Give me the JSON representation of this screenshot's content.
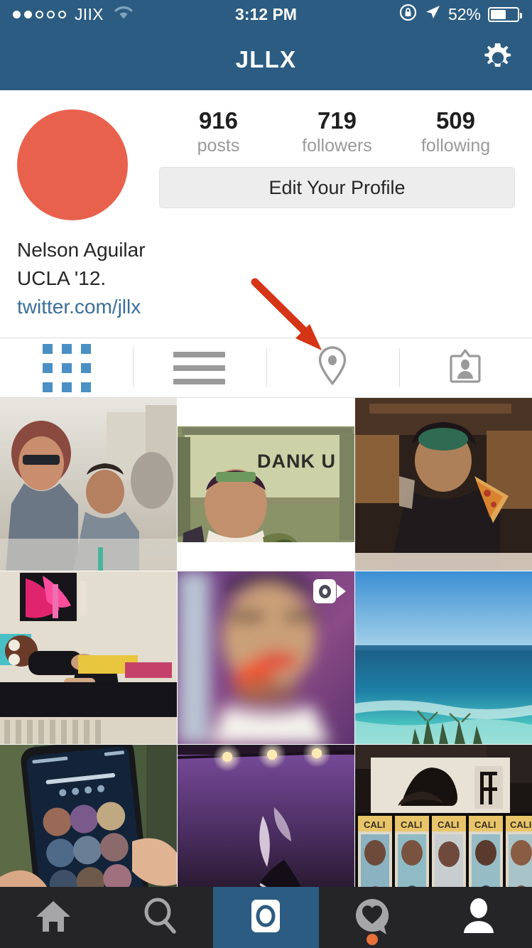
{
  "status_bar": {
    "carrier": "JIIX",
    "signal_filled": 2,
    "signal_total": 5,
    "wifi_icon": "wifi-icon",
    "time": "3:12 PM",
    "rotation_lock_icon": "rotation-lock-icon",
    "location_icon": "location-arrow-icon",
    "battery_percent": "52%",
    "battery_level": 52,
    "background_color": "#2C5C82"
  },
  "nav": {
    "title": "JLLX",
    "settings_icon": "gear-icon",
    "background_color": "#2C5C82"
  },
  "profile": {
    "avatar_color": "#E8614D",
    "stats": [
      {
        "value": "916",
        "label": "posts"
      },
      {
        "value": "719",
        "label": "followers"
      },
      {
        "value": "509",
        "label": "following"
      }
    ],
    "edit_button_label": "Edit Your Profile",
    "name": "Nelson Aguilar",
    "bio": "UCLA '12.",
    "website": "twitter.com/jllx",
    "website_color": "#3B6E99"
  },
  "annotation": {
    "arrow_color": "#D63417",
    "points_at": "photo-map-tab"
  },
  "view_tabs": [
    {
      "name": "grid-view-tab",
      "icon": "grid-icon",
      "active": true,
      "active_color": "#4A90C4"
    },
    {
      "name": "list-view-tab",
      "icon": "list-icon",
      "active": false
    },
    {
      "name": "photo-map-tab",
      "icon": "map-pin-icon",
      "active": false
    },
    {
      "name": "photos-of-you-tab",
      "icon": "photo-badge-icon",
      "active": false
    }
  ],
  "photo_grid": {
    "columns": 3,
    "rows": 3,
    "cells": [
      {
        "name": "photo-street-friends",
        "description": "Two men sitting outdoors on a city street",
        "is_video": false
      },
      {
        "name": "photo-dank-u-sign",
        "description": "Man posing in front of a DANK U sign",
        "is_video": false,
        "caption_text": "DANK U"
      },
      {
        "name": "photo-pizza-restaurant",
        "description": "Man in hat holding a slice of pizza",
        "is_video": false
      },
      {
        "name": "photo-bedroom",
        "description": "Person lying on a bed in a bedroom",
        "is_video": false
      },
      {
        "name": "photo-blurry-selfie",
        "description": "Blurry close-up portrait",
        "is_video": true,
        "video_icon": "video-camera-icon"
      },
      {
        "name": "photo-ocean-beach",
        "description": "Ocean coastline with turquoise water",
        "is_video": false
      },
      {
        "name": "photo-iphone-lockscreen",
        "description": "Hand holding an iPhone showing Touch ID lock screen",
        "is_video": false
      },
      {
        "name": "photo-concert-lights",
        "description": "Purple stage lights at a concert",
        "is_video": false
      },
      {
        "name": "photo-california-ids",
        "description": "A row of California ID cards on a table",
        "is_video": false
      }
    ]
  },
  "tab_bar": {
    "background_color": "#252528",
    "active_color": "#2C5C82",
    "items": [
      {
        "name": "home-tab",
        "icon": "home-icon",
        "active": false
      },
      {
        "name": "search-tab",
        "icon": "search-icon",
        "active": false
      },
      {
        "name": "camera-tab",
        "icon": "camera-icon",
        "active": true
      },
      {
        "name": "activity-tab",
        "icon": "heart-speech-icon",
        "active": false,
        "has_notification": true,
        "notification_color": "#E8713A"
      },
      {
        "name": "profile-tab",
        "icon": "person-icon",
        "active": true
      }
    ]
  }
}
